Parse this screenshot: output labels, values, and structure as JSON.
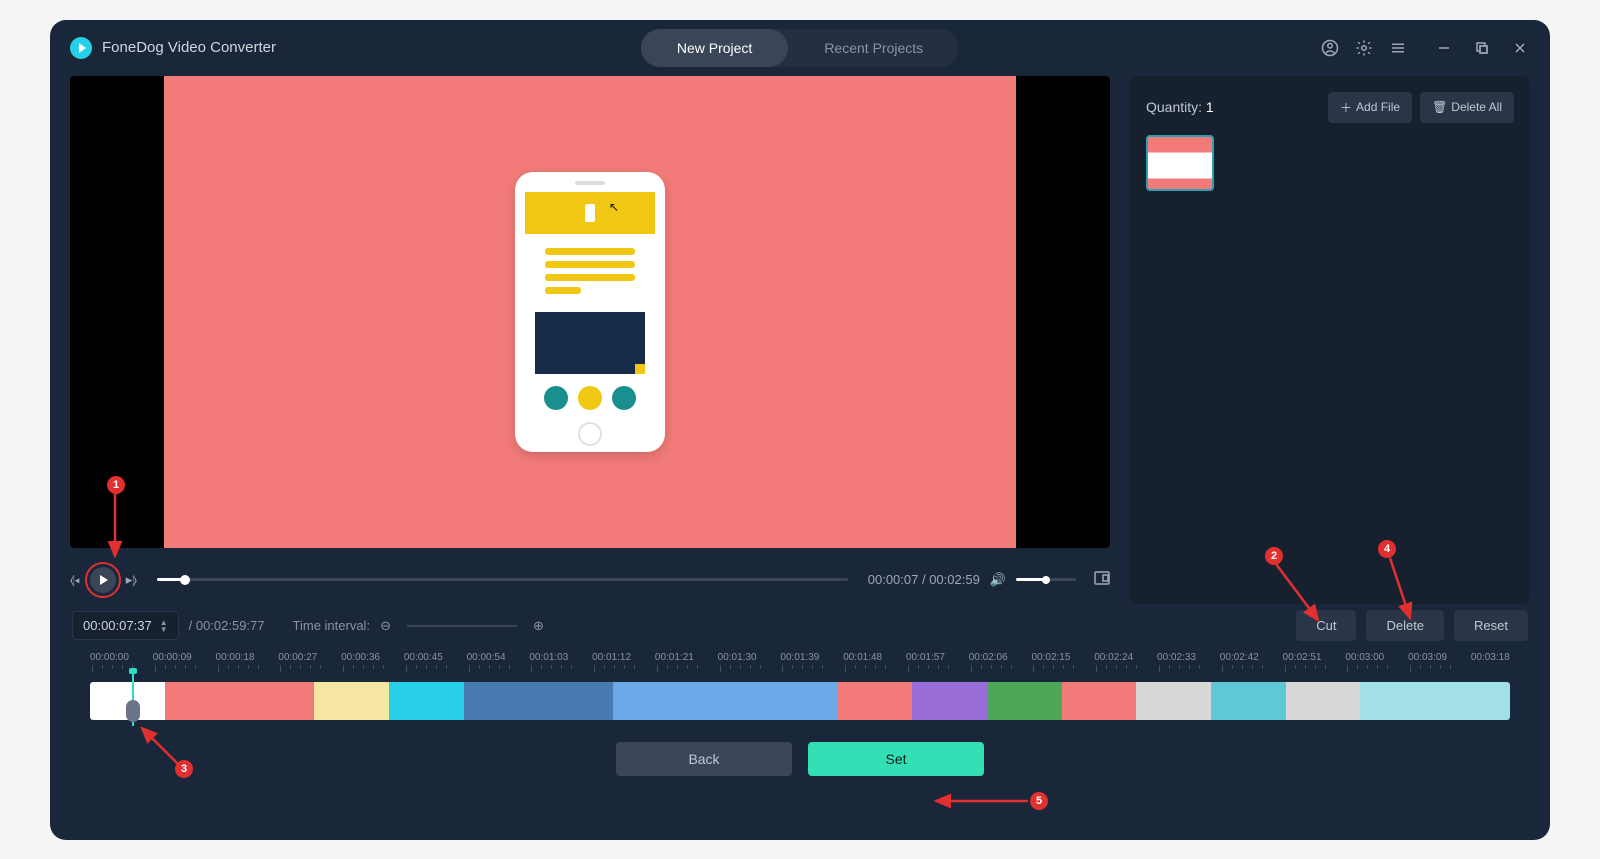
{
  "app": {
    "title": "FoneDog Video Converter"
  },
  "tabs": {
    "new_project": "New Project",
    "recent_projects": "Recent Projects"
  },
  "side": {
    "quantity_label": "Quantity:",
    "quantity_value": "1",
    "add_file": "Add File",
    "delete_all": "Delete All"
  },
  "playback": {
    "current": "00:00:07",
    "total": "00:02:59"
  },
  "toolbar": {
    "time_input": "00:00:07:37",
    "total_time": "/ 00:02:59:77",
    "interval_label": "Time interval:",
    "cut": "Cut",
    "delete": "Delete",
    "reset": "Reset"
  },
  "ruler": [
    "00:00:00",
    "00:00:09",
    "00:00:18",
    "00:00:27",
    "00:00:36",
    "00:00:45",
    "00:00:54",
    "00:01:03",
    "00:01:12",
    "00:01:21",
    "00:01:30",
    "00:01:39",
    "00:01:48",
    "00:01:57",
    "00:02:06",
    "00:02:15",
    "00:02:24",
    "00:02:33",
    "00:02:42",
    "00:02:51",
    "00:03:00",
    "00:03:09",
    "00:03:18"
  ],
  "bottom": {
    "back": "Back",
    "set": "Set"
  },
  "annotations": {
    "n1": "1",
    "n2": "2",
    "n3": "3",
    "n4": "4",
    "n5": "5"
  }
}
